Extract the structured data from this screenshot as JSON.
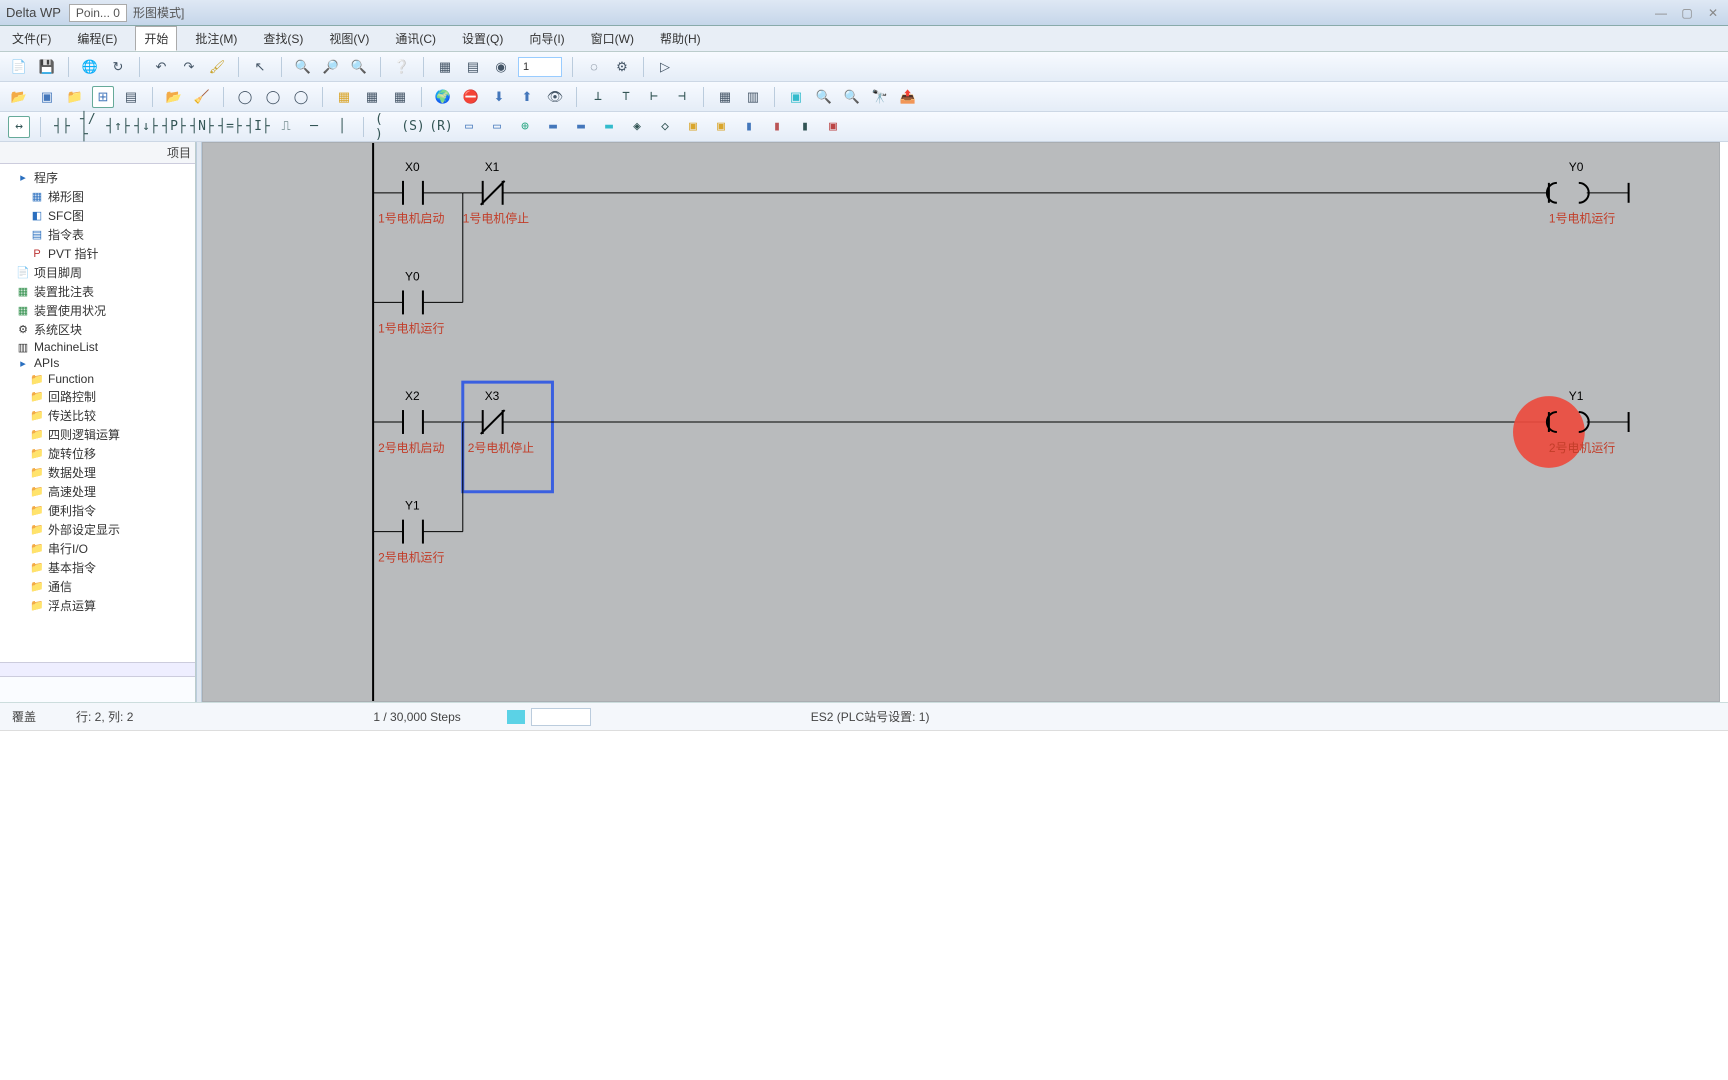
{
  "title": {
    "app": "Delta WP",
    "tab": "Poin... 0",
    "mode": "形图模式]"
  },
  "menu": {
    "items": [
      "文件(F)",
      "编程(E)",
      "开始",
      "批注(M)",
      "查找(S)",
      "视图(V)",
      "通讯(C)",
      "设置(Q)",
      "向导(I)",
      "窗口(W)",
      "帮助(H)"
    ],
    "active_index": 2
  },
  "toolbar1": {
    "zoom_field": "1"
  },
  "side": {
    "tab_label": "项目",
    "root": "程序",
    "root_children": [
      "梯形图",
      "SFC图",
      "指令表",
      "PVT 指针"
    ],
    "items": [
      "项目脚周",
      "装置批注表",
      "装置使用状况",
      "系统区块",
      "MachineList",
      "APIs"
    ],
    "api_children": [
      "Function",
      "回路控制",
      "传送比较",
      "四则逻辑运算",
      "旋转位移",
      "数据处理",
      "高速处理",
      "便利指令",
      "外部设定显示",
      "串行I/O",
      "基本指令",
      "通信",
      "浮点运算"
    ]
  },
  "ladder": {
    "rungs": [
      {
        "contacts": [
          {
            "addr": "X0",
            "type": "NO",
            "comment": "1号电机启动"
          },
          {
            "addr": "X1",
            "type": "NC",
            "comment": "1号电机停止"
          }
        ],
        "coil": {
          "addr": "Y0",
          "comment": "1号电机运行"
        },
        "branch": {
          "addr": "Y0",
          "type": "NO",
          "comment": "1号电机运行"
        }
      },
      {
        "contacts": [
          {
            "addr": "X2",
            "type": "NO",
            "comment": "2号电机启动"
          },
          {
            "addr": "X3",
            "type": "NC",
            "comment": "2号电机停止"
          }
        ],
        "coil": {
          "addr": "Y1",
          "comment": "2号电机运行"
        },
        "branch": {
          "addr": "Y1",
          "type": "NO",
          "comment": "2号电机运行"
        },
        "selected_col": 1
      }
    ]
  },
  "status": {
    "mode": "覆盖",
    "pos": "行: 2, 列: 2",
    "steps": "1 / 30,000 Steps",
    "plc": "ES2 (PLC站号设置: 1)"
  }
}
